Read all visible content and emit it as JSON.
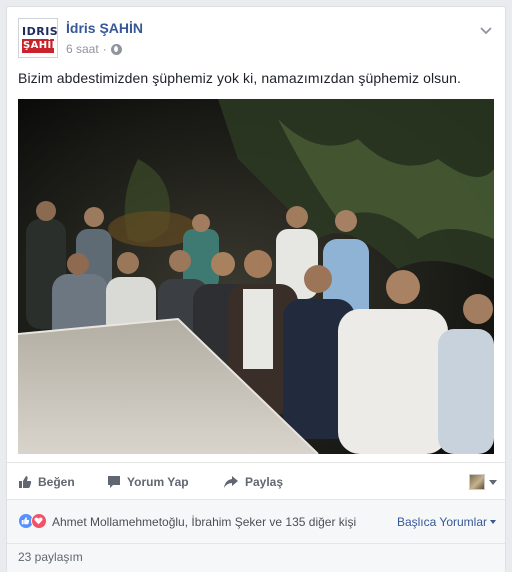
{
  "post": {
    "author_name": "İdris ŞAHİN",
    "timestamp": "6 saat",
    "meta_separator": "·",
    "audience_icon": "globe-icon",
    "text": "Bizim abdestimizden şüphemiz yok ki, namazımızdan şüphemiz olsun.",
    "logo": {
      "line1": "IDRIS",
      "line2": "ŞAHİN",
      "accent_color": "#c8232b",
      "text_color": "#1c2a5e"
    }
  },
  "actions": {
    "like_label": "Beğen",
    "comment_label": "Yorum Yap",
    "share_label": "Paylaş"
  },
  "reactions": {
    "summary": "Ahmet Mollamehmetoğlu, İbrahim Şeker ve 135 diğer kişi",
    "sort_label": "Başlıca Yorumlar",
    "like_color": "#5890ff",
    "love_color": "#f25268"
  },
  "shares": {
    "count_label": "23 paylaşım"
  },
  "colors": {
    "link": "#365899",
    "muted": "#90949c",
    "action": "#616770",
    "background": "#e9ebee"
  }
}
